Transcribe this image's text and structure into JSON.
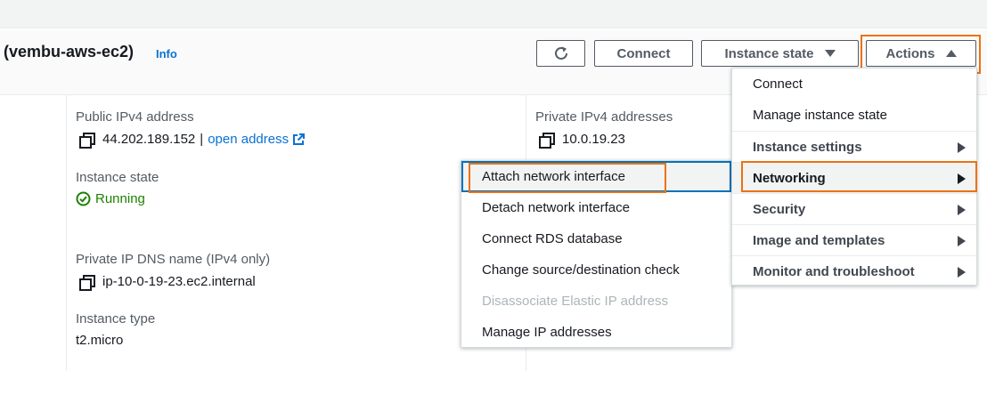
{
  "header": {
    "title": "(vembu-aws-ec2)",
    "info_label": "Info",
    "buttons": {
      "connect": "Connect",
      "instance_state": "Instance state",
      "actions": "Actions"
    }
  },
  "details": {
    "public_ipv4": {
      "label": "Public IPv4 address",
      "value": "44.202.189.152",
      "separator": "|",
      "link": "open address"
    },
    "private_ipv4": {
      "label": "Private IPv4 addresses",
      "value": "10.0.19.23"
    },
    "instance_state": {
      "label": "Instance state",
      "value": "Running"
    },
    "private_dns": {
      "label": "Private IP DNS name (IPv4 only)",
      "value": "ip-10-0-19-23.ec2.internal"
    },
    "instance_type": {
      "label": "Instance type",
      "value": "t2.micro"
    }
  },
  "actions_menu": {
    "items": [
      {
        "label": "Connect"
      },
      {
        "label": "Manage instance state"
      },
      {
        "label": "Instance settings"
      },
      {
        "label": "Networking"
      },
      {
        "label": "Security"
      },
      {
        "label": "Image and templates"
      },
      {
        "label": "Monitor and troubleshoot"
      }
    ]
  },
  "networking_submenu": {
    "items": [
      {
        "label": "Attach network interface"
      },
      {
        "label": "Detach network interface"
      },
      {
        "label": "Connect RDS database"
      },
      {
        "label": "Change source/destination check"
      },
      {
        "label": "Disassociate Elastic IP address",
        "disabled": true
      },
      {
        "label": "Manage IP addresses"
      }
    ]
  },
  "colors": {
    "highlight": "#ec7211",
    "link": "#0972d3",
    "success": "#1d8102",
    "focus": "#0073bb"
  },
  "icons": [
    "refresh-icon",
    "caret-down-icon",
    "caret-up-icon",
    "copy-icon",
    "external-link-icon",
    "check-circle-icon",
    "chevron-right-icon"
  ]
}
